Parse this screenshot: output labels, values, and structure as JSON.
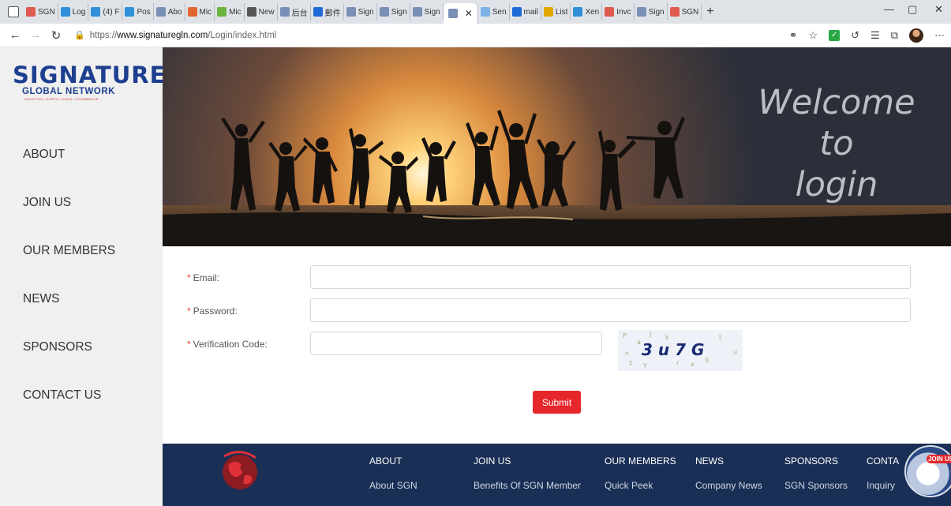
{
  "browser": {
    "tabs": [
      {
        "label": "SGN",
        "color": "#e05a4f"
      },
      {
        "label": "Log",
        "color": "#2f8fd9"
      },
      {
        "label": "(4) F",
        "color": "#2f8fd9"
      },
      {
        "label": "Pos",
        "color": "#2f8fd9"
      },
      {
        "label": "Abo",
        "color": "#7a8fb5"
      },
      {
        "label": "Mic",
        "color": "#e0662f"
      },
      {
        "label": "Mic",
        "color": "#6cb33f"
      },
      {
        "label": "New",
        "color": "#555555"
      },
      {
        "label": "后台",
        "color": "#7a8fb5"
      },
      {
        "label": "郵件",
        "color": "#1e6bd6"
      },
      {
        "label": "Sign",
        "color": "#7a8fb5"
      },
      {
        "label": "Sign",
        "color": "#7a8fb5"
      },
      {
        "label": "Sign",
        "color": "#7a8fb5"
      },
      {
        "label": "",
        "color": "#7a8fb5",
        "active": true
      },
      {
        "label": "Sen",
        "color": "#7fb3e8"
      },
      {
        "label": "mail",
        "color": "#1e6bd6"
      },
      {
        "label": "List",
        "color": "#e0a800"
      },
      {
        "label": "Xen",
        "color": "#2f8fd9"
      },
      {
        "label": "Invc",
        "color": "#e05a4f"
      },
      {
        "label": "Sign",
        "color": "#7a8fb5"
      },
      {
        "label": "SGN",
        "color": "#e05a4f"
      }
    ],
    "url_prefix": "https://",
    "url_host": "www.signaturegln.com",
    "url_path": "/Login/index.html"
  },
  "logo": {
    "main": "SIGNATURE",
    "sub": "GLOBAL NETWORK",
    "tagline": "LOGISTICS • SUPPLY CHAIN • ECOMMERCE"
  },
  "sidebar": {
    "items": [
      "ABOUT",
      "JOIN US",
      "OUR MEMBERS",
      "NEWS",
      "SPONSORS",
      "CONTACT US"
    ]
  },
  "hero": {
    "welcome_line1": "Welcome",
    "welcome_line2": "to",
    "welcome_line3": "login"
  },
  "form": {
    "required_mark": "*",
    "email_label": "Email:",
    "password_label": "Password:",
    "code_label": "Verification Code:",
    "captcha_text": "3 u 7 G",
    "submit_label": "Submit"
  },
  "footer": {
    "columns": [
      {
        "head": "ABOUT",
        "link": "About SGN"
      },
      {
        "head": "JOIN US",
        "link": "Benefits Of SGN Member"
      },
      {
        "head": "OUR MEMBERS",
        "link": "Quick Peek"
      },
      {
        "head": "NEWS",
        "link": "Company News"
      },
      {
        "head": "SPONSORS",
        "link": "SGN Sponsors"
      },
      {
        "head": "CONTA",
        "link": "Inquiry"
      }
    ],
    "join_badge": "JOIN US"
  },
  "colors": {
    "brand_blue": "#1d3f8f",
    "accent_red": "#e5272c",
    "footer_bg": "#1a2f55"
  }
}
